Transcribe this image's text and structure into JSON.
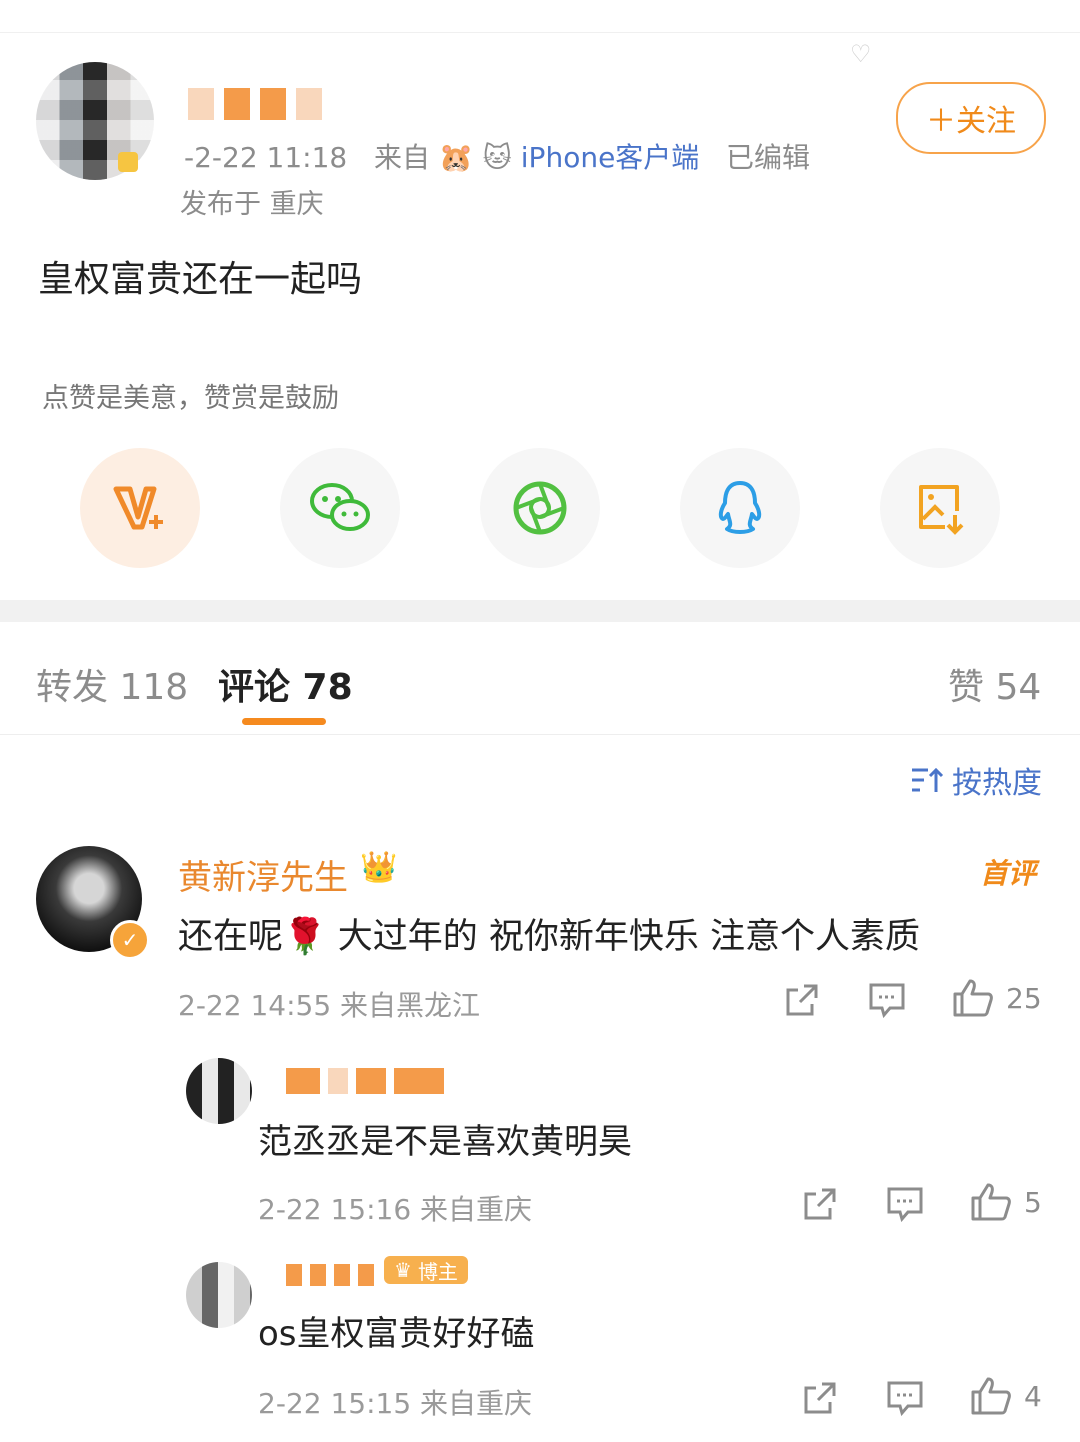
{
  "post": {
    "meta_date": "-2-22 11:18",
    "meta_from": "来自",
    "meta_client": "iPhone客户端",
    "meta_edited": "已编辑",
    "location": "发布于 重庆",
    "text": "皇权富贵还在一起吗",
    "follow_label": "＋关注",
    "reward_hint": "点赞是美意，赞赏是鼓励"
  },
  "share": {
    "items": [
      {
        "icon": "vplus-icon"
      },
      {
        "icon": "wechat-icon"
      },
      {
        "icon": "moments-icon"
      },
      {
        "icon": "qq-icon"
      },
      {
        "icon": "save-image-icon"
      }
    ]
  },
  "tabs": {
    "repost": "转发 118",
    "comment": "评论 78",
    "like": "赞 54"
  },
  "sort_label": "按热度",
  "comments": {
    "c1": {
      "name": "黄新淳先生",
      "badge": "首评",
      "text": "还在呢🌹 大过年的 祝你新年快乐 注意个人素质",
      "time": "2-22 14:55 来自黑龙江",
      "likes": "25"
    },
    "r1": {
      "text": "范丞丞是不是喜欢黄明昊",
      "time": "2-22 15:16 来自重庆",
      "likes": "5"
    },
    "r2": {
      "badge": "博主",
      "text": "os皇权富贵好好磕",
      "time": "2-22 15:15 来自重庆",
      "likes": "4"
    }
  },
  "colors": {
    "accent": "#f58a1f",
    "link_blue": "#4a74c9",
    "gray_text": "#8c8c8c"
  }
}
